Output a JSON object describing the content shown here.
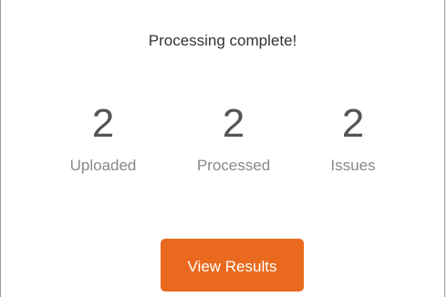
{
  "status": {
    "message": "Processing complete!"
  },
  "stats": [
    {
      "value": "2",
      "label": "Uploaded"
    },
    {
      "value": "2",
      "label": "Processed"
    },
    {
      "value": "2",
      "label": "Issues"
    }
  ],
  "actions": {
    "view_results_label": "View Results"
  },
  "colors": {
    "accent": "#e96a1f",
    "value_text": "#555555",
    "label_text": "#888888"
  }
}
